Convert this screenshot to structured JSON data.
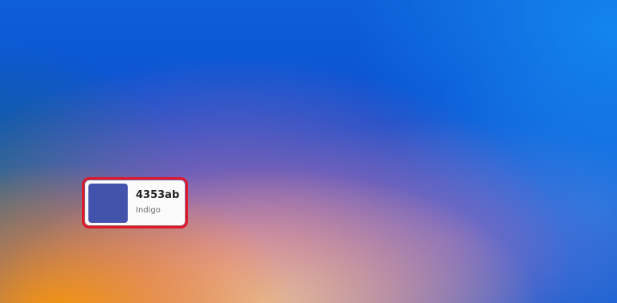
{
  "color_card": {
    "hex": "4353ab",
    "name": "Indigo",
    "swatch_color": "#4353ab",
    "highlight_color": "#e0182c"
  },
  "wallpaper": {
    "colors": [
      "#0a4fd1",
      "#ff9600",
      "#e66e96",
      "#1e6e6e"
    ]
  }
}
